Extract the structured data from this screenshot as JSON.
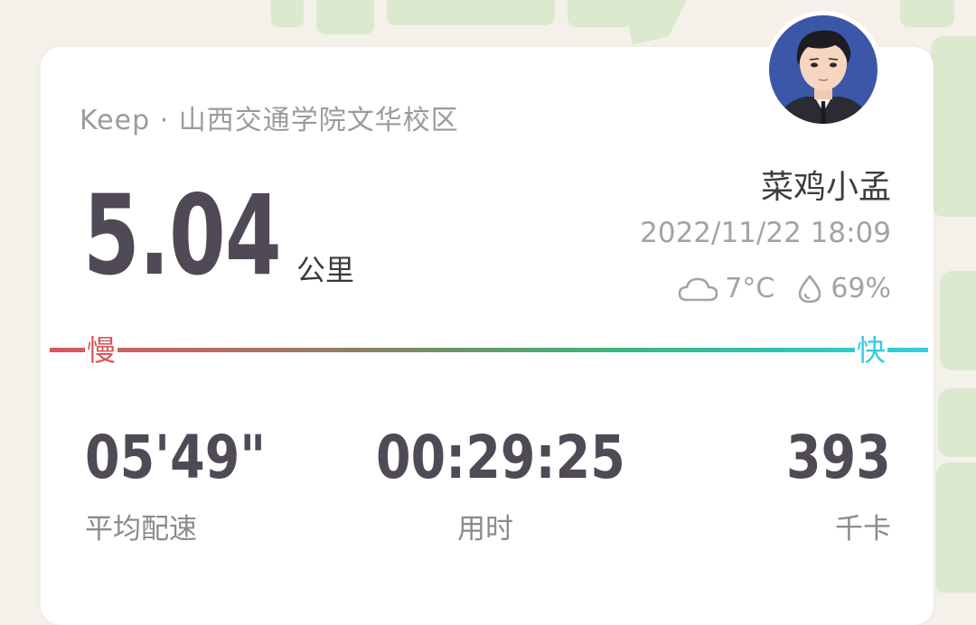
{
  "header": {
    "source": "Keep · 山西交通学院文华校区"
  },
  "run": {
    "distance": "5.04",
    "distance_unit": "公里"
  },
  "user": {
    "name": "菜鸡小孟",
    "datetime": "2022/11/22 18:09"
  },
  "weather": {
    "temperature": "7°C",
    "humidity": "69%",
    "icons": [
      "cloud-icon",
      "water-drop-icon"
    ]
  },
  "pace_scale": {
    "slow_label": "慢",
    "fast_label": "快",
    "colors": [
      "#d8575a",
      "#42b27a",
      "#32d0e2"
    ]
  },
  "stats": [
    {
      "value": "05'49\"",
      "label": "平均配速"
    },
    {
      "value": "00:29:25",
      "label": "用时"
    },
    {
      "value": "393",
      "label": "千卡"
    }
  ],
  "colors": {
    "map_background": "#f3f1e9",
    "map_green": "#dbe9cf",
    "text_dark": "#4f4a55",
    "text_muted": "#9b9b9b"
  }
}
